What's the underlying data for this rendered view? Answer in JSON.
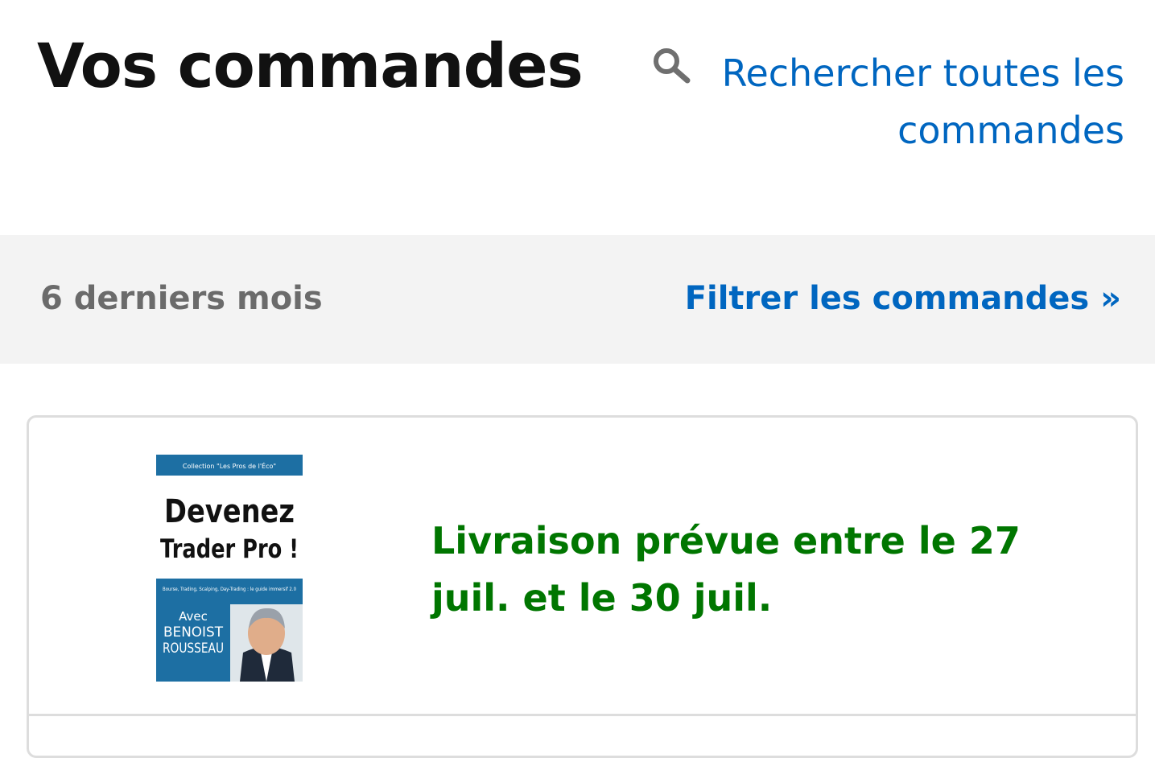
{
  "header": {
    "title": "Vos commandes",
    "search_link": "Rechercher toutes les commandes",
    "search_icon": "search-icon"
  },
  "filter_bar": {
    "period": "6 derniers mois",
    "filter_link": "Filtrer les commandes »"
  },
  "orders": [
    {
      "delivery_status": "Livraison prévue entre le 27 juil. et le 30 juil.",
      "product_cover": {
        "collection": "Collection \"Les Pros de l'Éco\"",
        "title_line1": "Devenez",
        "title_line2": "Trader Pro !",
        "subtitle": "Bourse, Trading, Scalping, Day-Trading : le guide immersif 2.0",
        "author_prefix": "Avec",
        "author_line1": "BENOIST",
        "author_line2": "ROUSSEAU"
      }
    }
  ],
  "colors": {
    "link": "#0066c0",
    "delivery": "#007600",
    "filter_bar_bg": "#f3f3f3",
    "title": "#111111",
    "muted": "#6b6b6b",
    "cover_blue": "#1d6fa3"
  }
}
